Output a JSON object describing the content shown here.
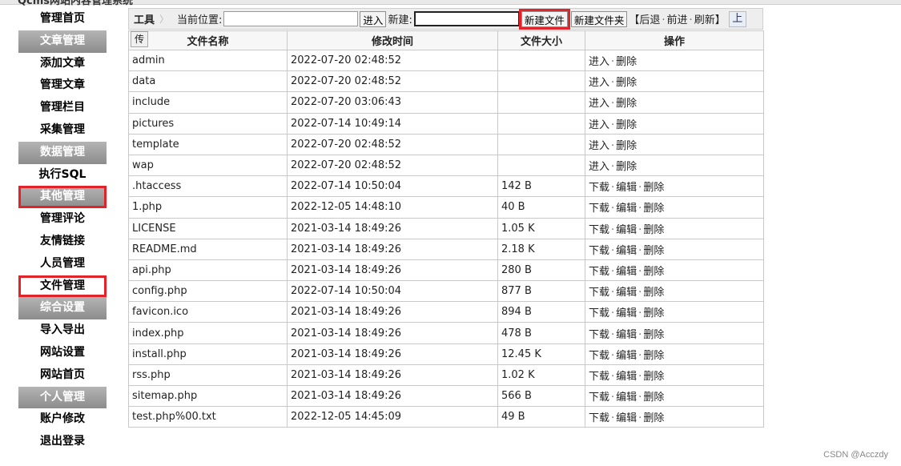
{
  "window": {
    "title": "Qcms网站内容管理系统"
  },
  "sidebar": {
    "items": [
      {
        "label": "管理首页",
        "type": "link",
        "highlight": false
      },
      {
        "label": "文章管理",
        "type": "category",
        "highlight": false
      },
      {
        "label": "添加文章",
        "type": "link",
        "highlight": false
      },
      {
        "label": "管理文章",
        "type": "link",
        "highlight": false
      },
      {
        "label": "管理栏目",
        "type": "link",
        "highlight": false
      },
      {
        "label": "采集管理",
        "type": "link",
        "highlight": false
      },
      {
        "label": "数据管理",
        "type": "category",
        "highlight": false
      },
      {
        "label": "执行SQL",
        "type": "link",
        "highlight": false
      },
      {
        "label": "其他管理",
        "type": "category",
        "highlight": true
      },
      {
        "label": "管理评论",
        "type": "link",
        "highlight": false
      },
      {
        "label": "友情链接",
        "type": "link",
        "highlight": false
      },
      {
        "label": "人员管理",
        "type": "link",
        "highlight": false
      },
      {
        "label": "文件管理",
        "type": "link",
        "highlight": true
      },
      {
        "label": "综合设置",
        "type": "category",
        "highlight": false
      },
      {
        "label": "导入导出",
        "type": "link",
        "highlight": false
      },
      {
        "label": "网站设置",
        "type": "link",
        "highlight": false
      },
      {
        "label": "网站首页",
        "type": "link",
        "highlight": false
      },
      {
        "label": "个人管理",
        "type": "category",
        "highlight": false
      },
      {
        "label": "账户修改",
        "type": "link",
        "highlight": false
      },
      {
        "label": "退出登录",
        "type": "link",
        "highlight": false
      }
    ]
  },
  "toolbar": {
    "tools_label": "工具",
    "current_location_label": "当前位置:",
    "location_value": "",
    "enter_button": "进入",
    "new_label": "新建:",
    "new_value": "",
    "new_file_button": "新建文件",
    "new_folder_button": "新建文件夹",
    "bracket_open": "【",
    "back": "后退",
    "forward": "前进",
    "refresh": "刷新",
    "bracket_close": "】",
    "up_button": "上"
  },
  "table": {
    "upload_tab": "传",
    "headers": [
      "文件名称",
      "修改时间",
      "文件大小",
      "操作"
    ],
    "rows": [
      {
        "name": "admin",
        "time": "2022-07-20 02:48:52",
        "size": "",
        "actions": [
          "进入",
          "删除"
        ]
      },
      {
        "name": "data",
        "time": "2022-07-20 02:48:52",
        "size": "",
        "actions": [
          "进入",
          "删除"
        ]
      },
      {
        "name": "include",
        "time": "2022-07-20 03:06:43",
        "size": "",
        "actions": [
          "进入",
          "删除"
        ]
      },
      {
        "name": "pictures",
        "time": "2022-07-14 10:49:14",
        "size": "",
        "actions": [
          "进入",
          "删除"
        ]
      },
      {
        "name": "template",
        "time": "2022-07-20 02:48:52",
        "size": "",
        "actions": [
          "进入",
          "删除"
        ]
      },
      {
        "name": "wap",
        "time": "2022-07-20 02:48:52",
        "size": "",
        "actions": [
          "进入",
          "删除"
        ]
      },
      {
        "name": ".htaccess",
        "time": "2022-07-14 10:50:04",
        "size": "142 B",
        "actions": [
          "下载",
          "编辑",
          "删除"
        ]
      },
      {
        "name": "1.php",
        "time": "2022-12-05 14:48:10",
        "size": "40 B",
        "actions": [
          "下载",
          "编辑",
          "删除"
        ]
      },
      {
        "name": "LICENSE",
        "time": "2021-03-14 18:49:26",
        "size": "1.05 K",
        "actions": [
          "下载",
          "编辑",
          "删除"
        ]
      },
      {
        "name": "README.md",
        "time": "2021-03-14 18:49:26",
        "size": "2.18 K",
        "actions": [
          "下载",
          "编辑",
          "删除"
        ]
      },
      {
        "name": "api.php",
        "time": "2021-03-14 18:49:26",
        "size": "280 B",
        "actions": [
          "下载",
          "编辑",
          "删除"
        ]
      },
      {
        "name": "config.php",
        "time": "2022-07-14 10:50:04",
        "size": "877 B",
        "actions": [
          "下载",
          "编辑",
          "删除"
        ]
      },
      {
        "name": "favicon.ico",
        "time": "2021-03-14 18:49:26",
        "size": "894 B",
        "actions": [
          "下载",
          "编辑",
          "删除"
        ]
      },
      {
        "name": "index.php",
        "time": "2021-03-14 18:49:26",
        "size": "478 B",
        "actions": [
          "下载",
          "编辑",
          "删除"
        ]
      },
      {
        "name": "install.php",
        "time": "2021-03-14 18:49:26",
        "size": "12.45 K",
        "actions": [
          "下载",
          "编辑",
          "删除"
        ]
      },
      {
        "name": "rss.php",
        "time": "2021-03-14 18:49:26",
        "size": "1.02 K",
        "actions": [
          "下载",
          "编辑",
          "删除"
        ]
      },
      {
        "name": "sitemap.php",
        "time": "2021-03-14 18:49:26",
        "size": "566 B",
        "actions": [
          "下载",
          "编辑",
          "删除"
        ]
      },
      {
        "name": "test.php%00.txt",
        "time": "2022-12-05 14:45:09",
        "size": "49 B",
        "actions": [
          "下载",
          "编辑",
          "删除"
        ]
      }
    ]
  },
  "watermark": "CSDN @Acczdy",
  "colors": {
    "highlight_red": "#e2232a",
    "category_gray": "#9c9c9c"
  }
}
